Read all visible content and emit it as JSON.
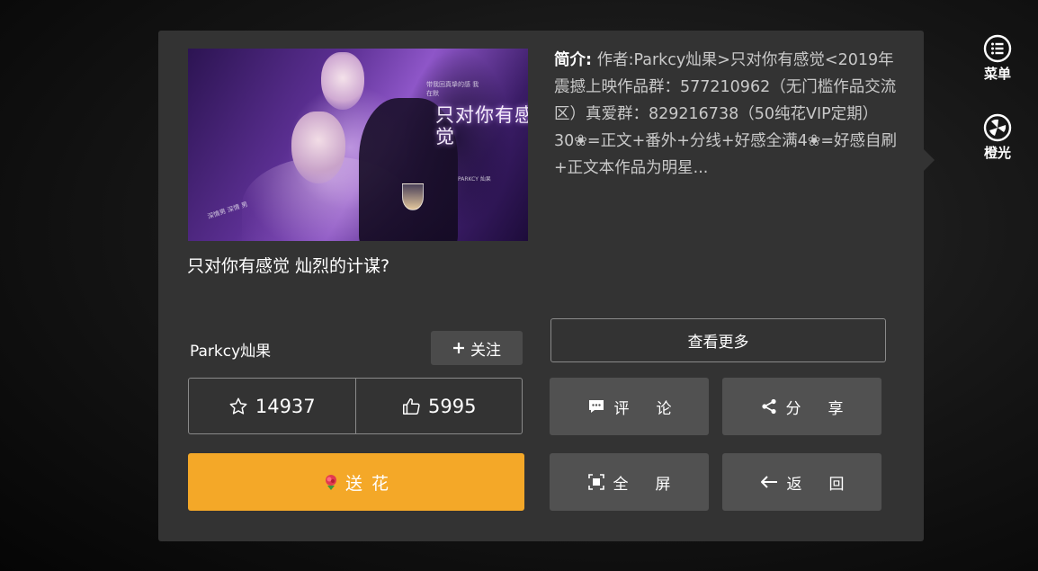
{
  "book": {
    "title": "只对你有感觉 灿烈的计谋?",
    "cover_title": "只对你有感觉",
    "cover_small_1": "带我回真挚的感 我在默",
    "cover_small_2": "深情男 深情 男",
    "cover_small_3": "PARKCY 灿果"
  },
  "intro": {
    "label": "简介:",
    "text": "作者:Parkcy灿果>只对你有感觉<2019年震撼上映作品群：577210962（无门槛作品交流区）真爱群：829216738（50纯花VIP定期）30❀=正文+番外+分线+好感全满4❀=好感自刷+正文本作品为明星..."
  },
  "author": {
    "name": "Parkcy灿果",
    "follow_label": "关注",
    "follow_icon": "plus-icon"
  },
  "see_more_label": "查看更多",
  "stats": {
    "favorites": "14937",
    "likes": "5995"
  },
  "send_flower_label": "送 花",
  "actions": {
    "comment": "评论",
    "share": "分享",
    "fullscreen": "全屏",
    "back": "返回"
  },
  "side": {
    "menu_label": "菜单",
    "light_label": "橙光"
  },
  "colors": {
    "panel": "#333333",
    "flower_button": "#f4a828",
    "action_button": "#515151"
  }
}
